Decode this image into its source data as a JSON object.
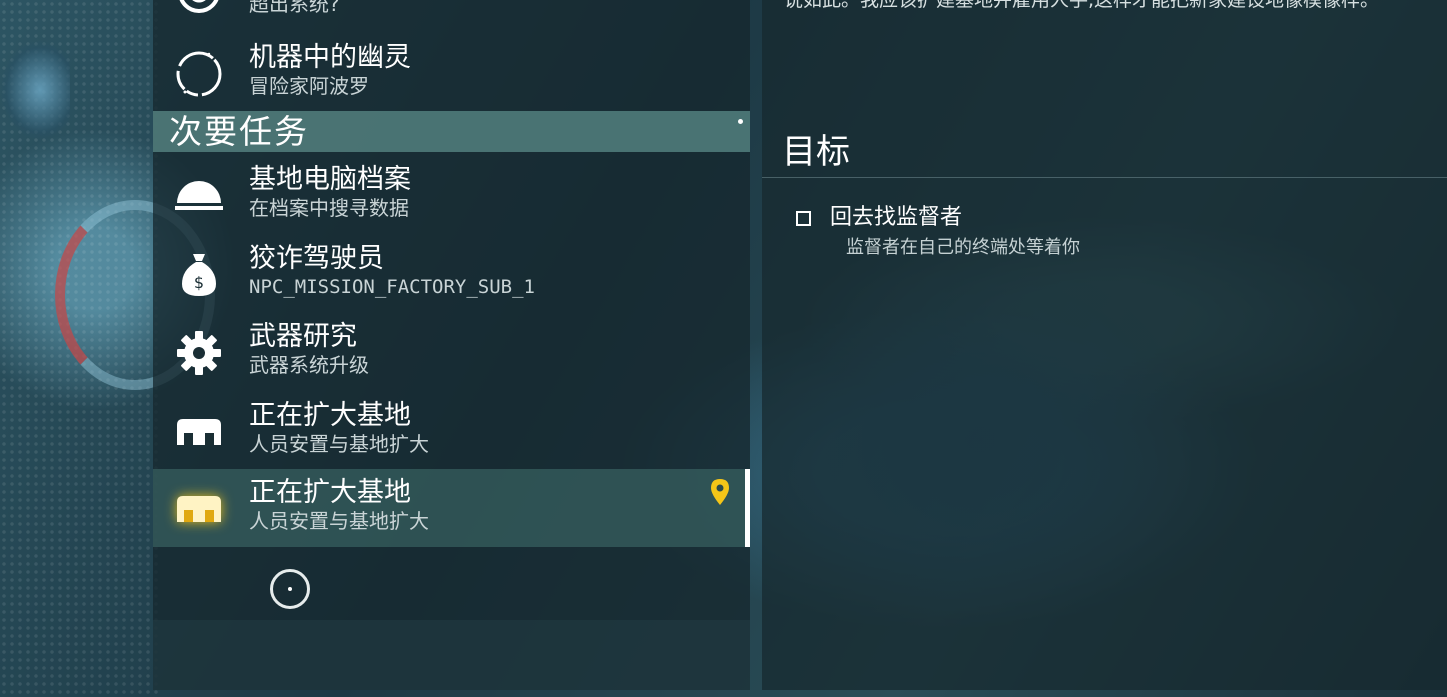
{
  "primary_missions": [
    {
      "title": "",
      "subtitle": "超出系统?",
      "icon": "circle-emblem-icon"
    },
    {
      "title": "机器中的幽灵",
      "subtitle": "冒险家阿波罗",
      "icon": "glitch-circle-icon"
    }
  ],
  "secondary_section": {
    "label": "次要任务"
  },
  "secondary_missions": [
    {
      "title": "基地电脑档案",
      "subtitle": "在档案中搜寻数据",
      "icon": "dome-icon"
    },
    {
      "title": "狡诈驾驶员",
      "subtitle": "NPC_MISSION_FACTORY_SUB_1",
      "icon": "money-bag-icon"
    },
    {
      "title": "武器研究",
      "subtitle": "武器系统升级",
      "icon": "gear-icon"
    },
    {
      "title": "正在扩大基地",
      "subtitle": "人员安置与基地扩大",
      "icon": "base-building-icon"
    },
    {
      "title": "正在扩大基地",
      "subtitle": "人员安置与基地扩大",
      "icon": "base-building-icon",
      "selected": true
    }
  ],
  "details": {
    "description_tail": "说如此。我应该扩建基地并雇用人手,这样才能把新家建设地像模像样。",
    "objectives_title": "目标",
    "objectives": [
      {
        "title": "回去找监督者",
        "description": "监督者在自己的终端处等着你",
        "completed": false
      }
    ]
  },
  "colors": {
    "highlight_yellow": "#f5c518",
    "panel_dark": "#16282e",
    "section_teal": "#4e7a78"
  }
}
